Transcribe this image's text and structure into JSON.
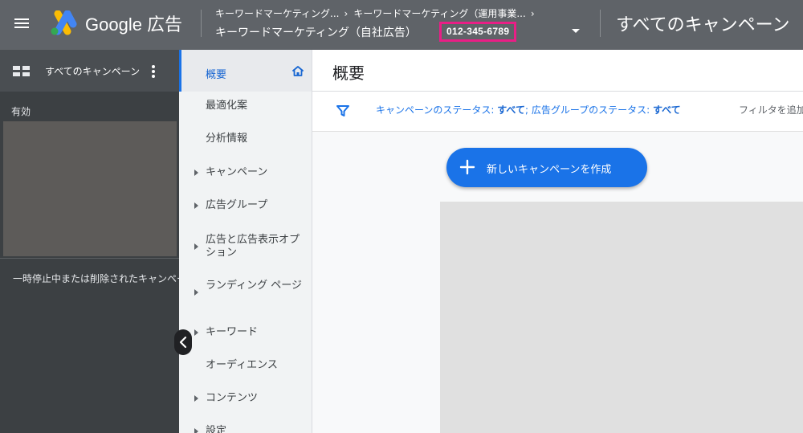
{
  "header": {
    "brand": "Google 広告",
    "breadcrumbs": [
      "キーワードマーケティング...",
      "キーワードマーケティング（運用事業..."
    ],
    "account_name": "キーワードマーケティング（自社広告）",
    "customer_id": "012-345-6789",
    "page_title": "すべてのキャンペーン",
    "icons": [
      "menu-icon",
      "google-ads-logo",
      "chevron-right-icon",
      "dropdown-arrow-icon"
    ]
  },
  "left_panel": {
    "title": "すべてのキャンペーン",
    "enabled_label": "有効",
    "paused_label": "一時停止中または削除されたキャンペーン"
  },
  "nav": {
    "active": "概要",
    "items": [
      {
        "label": "最適化案",
        "expandable": false
      },
      {
        "label": "分析情報",
        "expandable": false
      },
      {
        "label": "キャンペーン",
        "expandable": true
      },
      {
        "label": "広告グループ",
        "expandable": true
      },
      {
        "label": "広告と広告表示オプション",
        "expandable": true
      },
      {
        "label": "ランディング ページ",
        "expandable": true
      },
      {
        "label": "キーワード",
        "expandable": true
      },
      {
        "label": "オーディエンス",
        "expandable": false
      },
      {
        "label": "コンテンツ",
        "expandable": true
      },
      {
        "label": "設定",
        "expandable": true
      }
    ]
  },
  "main": {
    "title": "概要",
    "filter": {
      "campaign_status_label": "キャンペーンのステータス: ",
      "campaign_status_value": "すべて",
      "separator": "; ",
      "adgroup_status_label": "広告グループのステータス: ",
      "adgroup_status_value": "すべて",
      "add_filter": "フィルタを追加"
    },
    "new_campaign_button": "新しいキャンペーンを作成"
  },
  "colors": {
    "header_bg": "#5f6368",
    "left_panel_bg": "#3c4043",
    "accent_blue": "#1a73e8",
    "highlight_border": "#e91e86"
  }
}
